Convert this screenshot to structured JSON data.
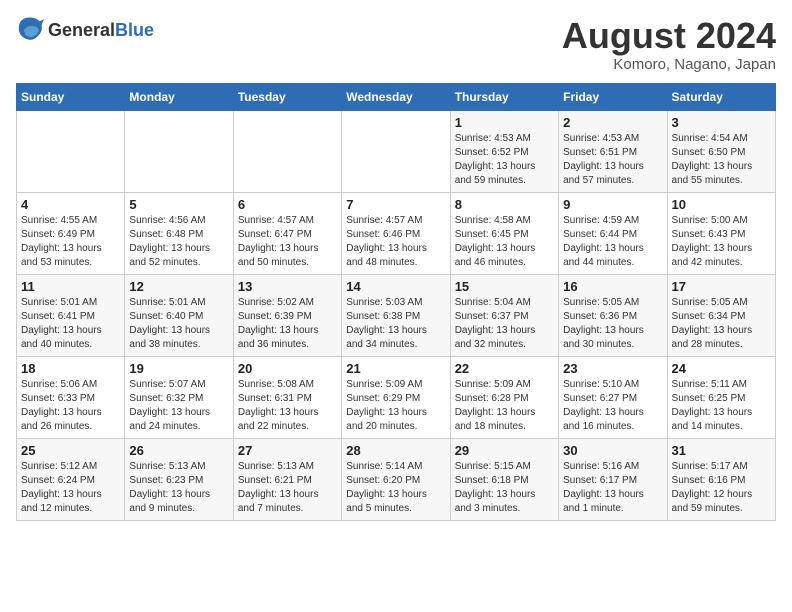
{
  "header": {
    "logo_general": "General",
    "logo_blue": "Blue",
    "main_title": "August 2024",
    "subtitle": "Komoro, Nagano, Japan"
  },
  "days_of_week": [
    "Sunday",
    "Monday",
    "Tuesday",
    "Wednesday",
    "Thursday",
    "Friday",
    "Saturday"
  ],
  "weeks": [
    [
      {
        "day": "",
        "detail": ""
      },
      {
        "day": "",
        "detail": ""
      },
      {
        "day": "",
        "detail": ""
      },
      {
        "day": "",
        "detail": ""
      },
      {
        "day": "1",
        "detail": "Sunrise: 4:53 AM\nSunset: 6:52 PM\nDaylight: 13 hours\nand 59 minutes."
      },
      {
        "day": "2",
        "detail": "Sunrise: 4:53 AM\nSunset: 6:51 PM\nDaylight: 13 hours\nand 57 minutes."
      },
      {
        "day": "3",
        "detail": "Sunrise: 4:54 AM\nSunset: 6:50 PM\nDaylight: 13 hours\nand 55 minutes."
      }
    ],
    [
      {
        "day": "4",
        "detail": "Sunrise: 4:55 AM\nSunset: 6:49 PM\nDaylight: 13 hours\nand 53 minutes."
      },
      {
        "day": "5",
        "detail": "Sunrise: 4:56 AM\nSunset: 6:48 PM\nDaylight: 13 hours\nand 52 minutes."
      },
      {
        "day": "6",
        "detail": "Sunrise: 4:57 AM\nSunset: 6:47 PM\nDaylight: 13 hours\nand 50 minutes."
      },
      {
        "day": "7",
        "detail": "Sunrise: 4:57 AM\nSunset: 6:46 PM\nDaylight: 13 hours\nand 48 minutes."
      },
      {
        "day": "8",
        "detail": "Sunrise: 4:58 AM\nSunset: 6:45 PM\nDaylight: 13 hours\nand 46 minutes."
      },
      {
        "day": "9",
        "detail": "Sunrise: 4:59 AM\nSunset: 6:44 PM\nDaylight: 13 hours\nand 44 minutes."
      },
      {
        "day": "10",
        "detail": "Sunrise: 5:00 AM\nSunset: 6:43 PM\nDaylight: 13 hours\nand 42 minutes."
      }
    ],
    [
      {
        "day": "11",
        "detail": "Sunrise: 5:01 AM\nSunset: 6:41 PM\nDaylight: 13 hours\nand 40 minutes."
      },
      {
        "day": "12",
        "detail": "Sunrise: 5:01 AM\nSunset: 6:40 PM\nDaylight: 13 hours\nand 38 minutes."
      },
      {
        "day": "13",
        "detail": "Sunrise: 5:02 AM\nSunset: 6:39 PM\nDaylight: 13 hours\nand 36 minutes."
      },
      {
        "day": "14",
        "detail": "Sunrise: 5:03 AM\nSunset: 6:38 PM\nDaylight: 13 hours\nand 34 minutes."
      },
      {
        "day": "15",
        "detail": "Sunrise: 5:04 AM\nSunset: 6:37 PM\nDaylight: 13 hours\nand 32 minutes."
      },
      {
        "day": "16",
        "detail": "Sunrise: 5:05 AM\nSunset: 6:36 PM\nDaylight: 13 hours\nand 30 minutes."
      },
      {
        "day": "17",
        "detail": "Sunrise: 5:05 AM\nSunset: 6:34 PM\nDaylight: 13 hours\nand 28 minutes."
      }
    ],
    [
      {
        "day": "18",
        "detail": "Sunrise: 5:06 AM\nSunset: 6:33 PM\nDaylight: 13 hours\nand 26 minutes."
      },
      {
        "day": "19",
        "detail": "Sunrise: 5:07 AM\nSunset: 6:32 PM\nDaylight: 13 hours\nand 24 minutes."
      },
      {
        "day": "20",
        "detail": "Sunrise: 5:08 AM\nSunset: 6:31 PM\nDaylight: 13 hours\nand 22 minutes."
      },
      {
        "day": "21",
        "detail": "Sunrise: 5:09 AM\nSunset: 6:29 PM\nDaylight: 13 hours\nand 20 minutes."
      },
      {
        "day": "22",
        "detail": "Sunrise: 5:09 AM\nSunset: 6:28 PM\nDaylight: 13 hours\nand 18 minutes."
      },
      {
        "day": "23",
        "detail": "Sunrise: 5:10 AM\nSunset: 6:27 PM\nDaylight: 13 hours\nand 16 minutes."
      },
      {
        "day": "24",
        "detail": "Sunrise: 5:11 AM\nSunset: 6:25 PM\nDaylight: 13 hours\nand 14 minutes."
      }
    ],
    [
      {
        "day": "25",
        "detail": "Sunrise: 5:12 AM\nSunset: 6:24 PM\nDaylight: 13 hours\nand 12 minutes."
      },
      {
        "day": "26",
        "detail": "Sunrise: 5:13 AM\nSunset: 6:23 PM\nDaylight: 13 hours\nand 9 minutes."
      },
      {
        "day": "27",
        "detail": "Sunrise: 5:13 AM\nSunset: 6:21 PM\nDaylight: 13 hours\nand 7 minutes."
      },
      {
        "day": "28",
        "detail": "Sunrise: 5:14 AM\nSunset: 6:20 PM\nDaylight: 13 hours\nand 5 minutes."
      },
      {
        "day": "29",
        "detail": "Sunrise: 5:15 AM\nSunset: 6:18 PM\nDaylight: 13 hours\nand 3 minutes."
      },
      {
        "day": "30",
        "detail": "Sunrise: 5:16 AM\nSunset: 6:17 PM\nDaylight: 13 hours\nand 1 minute."
      },
      {
        "day": "31",
        "detail": "Sunrise: 5:17 AM\nSunset: 6:16 PM\nDaylight: 12 hours\nand 59 minutes."
      }
    ]
  ]
}
